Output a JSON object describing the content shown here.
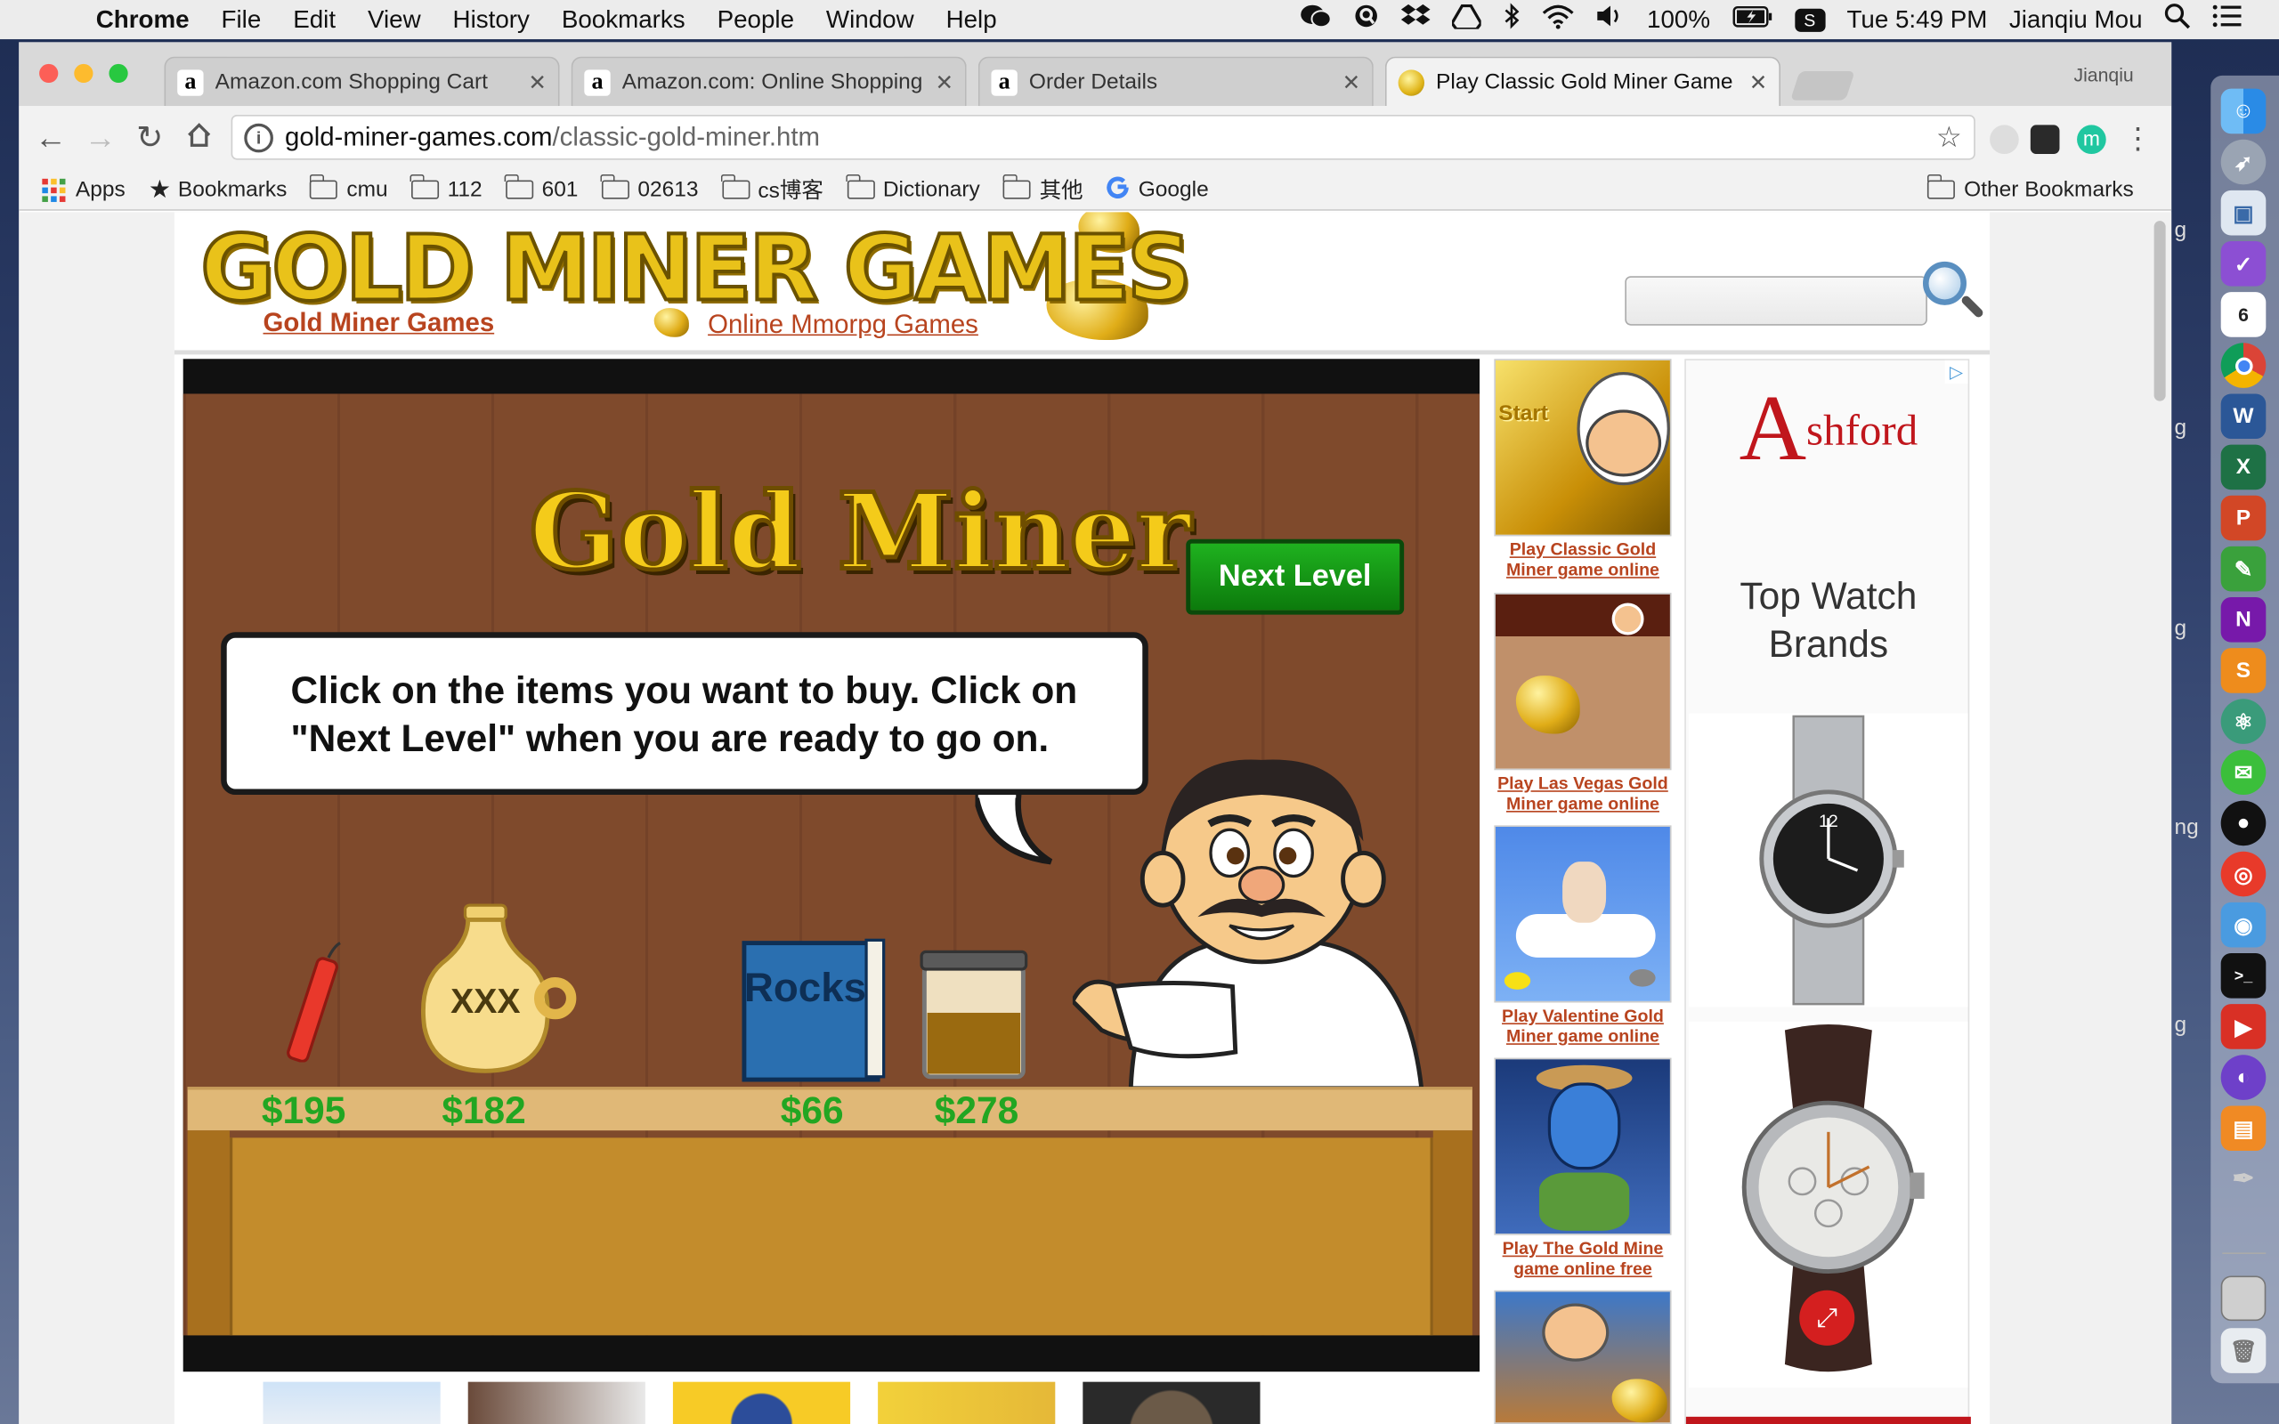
{
  "menubar": {
    "app": "Chrome",
    "menus": [
      "File",
      "Edit",
      "View",
      "History",
      "Bookmarks",
      "People",
      "Window",
      "Help"
    ],
    "battery": "100%",
    "clock": "Tue 5:49 PM",
    "user": "Jianqiu Mou"
  },
  "tabs": [
    {
      "title": "Amazon.com Shopping Cart",
      "favicon": "a"
    },
    {
      "title": "Amazon.com: Online Shopping",
      "favicon": "a"
    },
    {
      "title": "Order Details",
      "favicon": "a"
    },
    {
      "title": "Play Classic Gold Miner Game",
      "favicon": "gold"
    }
  ],
  "profile_name": "Jianqiu",
  "address": {
    "host": "gold-miner-games.com",
    "path": "/classic-gold-miner.htm"
  },
  "bookmarks": [
    "Apps",
    "Bookmarks",
    "cmu",
    "112",
    "601",
    "02613",
    "cs博客",
    "Dictionary",
    "其他",
    "Google"
  ],
  "other_bookmarks": "Other Bookmarks",
  "site": {
    "logo": "GOLD MINER GAMES",
    "links": [
      "Gold Miner Games",
      "Online Mmorpg Games"
    ]
  },
  "game": {
    "title": "Gold Miner",
    "next_level": "Next Level",
    "instructions_line1": "Click on the items you want to buy. Click on",
    "instructions_line2": "\"Next Level\" when you are ready to go on.",
    "items": [
      {
        "name": "dynamite",
        "price": "$195"
      },
      {
        "name": "strength potion",
        "label": "XXX",
        "price": "$182"
      },
      {
        "name": "rock collectors book",
        "label": "Rocks",
        "price": "$66"
      },
      {
        "name": "diamond polish",
        "price": "$278"
      }
    ]
  },
  "related_games": [
    "Play Classic Gold Miner game online free",
    "Play Las Vegas Gold Miner game online free",
    "Play Valentine Gold Miner game online free",
    "Play The Gold Mine game online free"
  ],
  "thumb_texts": {
    "start": "Start"
  },
  "ad": {
    "brand": "Ashford",
    "tagline_line1": "Top Watch",
    "tagline_line2": "Brands",
    "watch_dial_number": "12"
  },
  "calendar_day": "6"
}
